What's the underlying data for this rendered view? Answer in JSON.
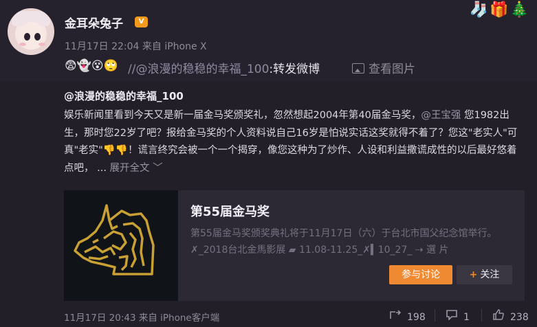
{
  "post": {
    "username": "金耳朵兔子",
    "vip_badge": "V",
    "meta": "11月17日 22:04 来自 iPhone X",
    "decor": "🧦🎁🎄",
    "emojis": "😨👻😵🙄",
    "repost_mention": "//@浪漫的稳稳的幸福_100",
    "repost_suffix": ":转发微博",
    "view_image": "查看图片"
  },
  "original": {
    "author": "@浪漫的稳稳的幸福_100",
    "text_part1": "娱乐新闻里看到今天又是新一届金马奖颁奖礼，忽然想起2004年第40届金马奖，",
    "mention": "@王宝强",
    "text_part2": " 您1982出生，那时您22岁了吧？报给金马奖的个人资料说自己16岁是怕说实话这奖就得不着了？您这\"老实人\"可真\"老实\"",
    "thumbs": "👎👎",
    "text_part3": "！谎言终究会被一个一个揭穿，像您这种为了炒作、人设和利益撒谎成性的以后最好悠着点吧，",
    "ellipsis": " ...",
    "expand": "展开全文",
    "expand_icon": "﹀"
  },
  "card": {
    "title": "第55届金马奖",
    "description": "第55届金马奖颁奖典礼将于11月17日（六）于台北市国父纪念馆举行。 ✗_2018台北金馬影展 ▰ 11.08-11.25_✗▍10_27_ ⇢ 選 片",
    "discuss_button": "参与讨论",
    "follow_plus": "+",
    "follow_button": "关注"
  },
  "footer": {
    "meta": "11月17日 20:43 来自 iPhone客户端",
    "repost_count": "198",
    "comment_count": "1",
    "like_count": "238"
  },
  "icons": {
    "share": "share-icon",
    "comment": "comment-icon",
    "like": "like-icon"
  },
  "colors": {
    "background": "#221f29",
    "accent": "#f08a32",
    "gold_logo": "#c9a033"
  }
}
